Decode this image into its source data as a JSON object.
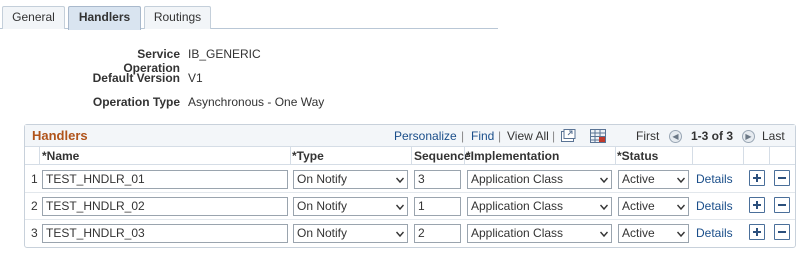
{
  "tabs": [
    {
      "label": "General"
    },
    {
      "label": "Handlers"
    },
    {
      "label": "Routings"
    }
  ],
  "info": {
    "service_operation_label": "Service Operation",
    "service_operation_value": "IB_GENERIC",
    "default_version_label": "Default Version",
    "default_version_value": "V1",
    "operation_type_label": "Operation Type",
    "operation_type_value": "Asynchronous - One Way"
  },
  "grid": {
    "title": "Handlers",
    "personalize": "Personalize",
    "find": "Find",
    "view_all": "View All",
    "first": "First",
    "range": "1-3 of 3",
    "last": "Last",
    "columns": {
      "name": "*Name",
      "type": "*Type",
      "sequence": "Sequence",
      "implementation": "*Implementation",
      "status": "*Status"
    },
    "rows": [
      {
        "num": "1",
        "name": "TEST_HNDLR_01",
        "type": "On Notify",
        "sequence": "3",
        "implementation": "Application Class",
        "status": "Active",
        "details": "Details"
      },
      {
        "num": "2",
        "name": "TEST_HNDLR_02",
        "type": "On Notify",
        "sequence": "1",
        "implementation": "Application Class",
        "status": "Active",
        "details": "Details"
      },
      {
        "num": "3",
        "name": "TEST_HNDLR_03",
        "type": "On Notify",
        "sequence": "2",
        "implementation": "Application Class",
        "status": "Active",
        "details": "Details"
      }
    ]
  },
  "colors": {
    "title": "#b0531a",
    "link": "#1a4e8a",
    "active_tab": "#d9e4f0"
  },
  "icons": {
    "zoom": "zoom-grid-icon",
    "download": "download-excel-icon",
    "prev": "prev-page-icon",
    "next": "next-page-icon",
    "add": "add-row-icon",
    "delete": "delete-row-icon",
    "dropdown": "chevron-down-icon"
  }
}
